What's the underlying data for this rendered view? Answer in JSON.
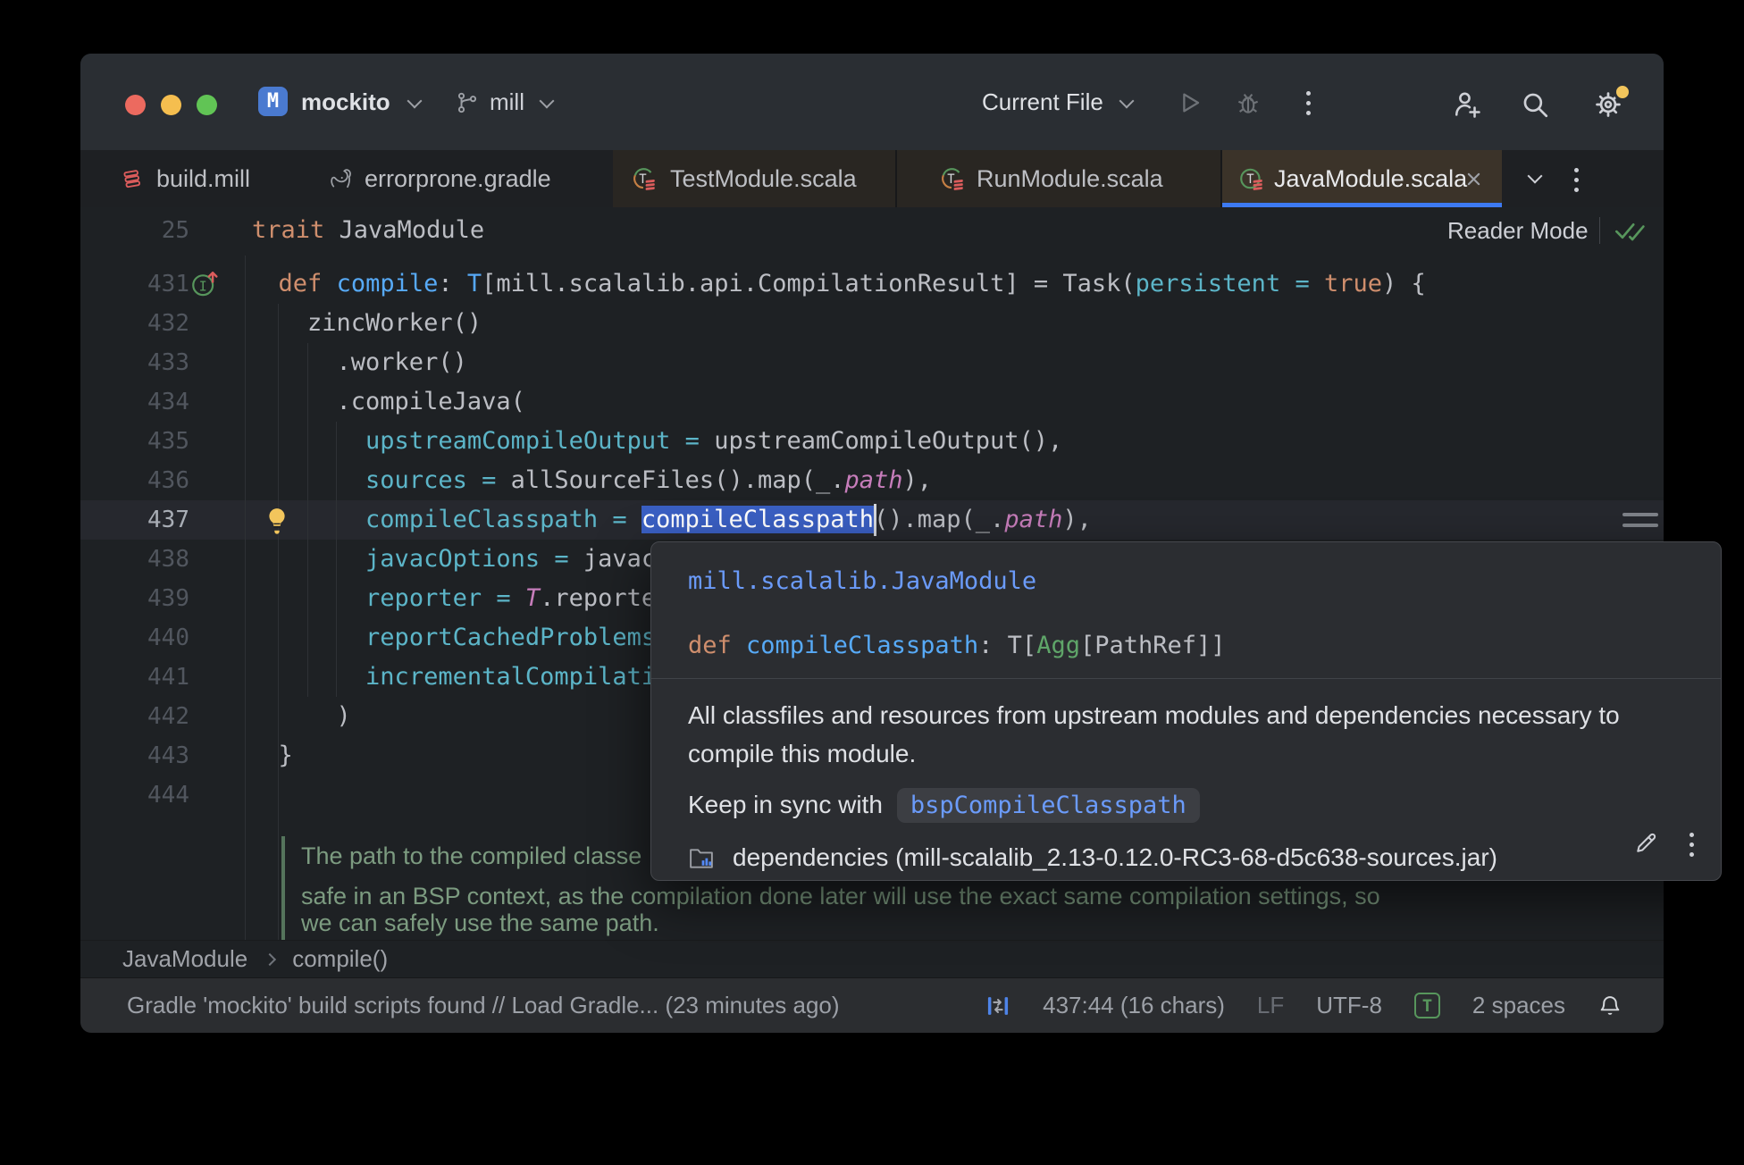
{
  "colors": {
    "accent_blue": "#3D7AF2",
    "selection_blue": "#3A5FC3",
    "link_blue": "#6B9BFA",
    "traffic_red": "#EC6A5F",
    "traffic_yellow": "#F5BE4F",
    "traffic_green": "#61C455",
    "notification_dot": "#F2C55C",
    "doc_comment_green": "#7C9B80"
  },
  "icons": {
    "project_badge": "M-letter-badge",
    "branch": "git-branch",
    "run": "play-triangle",
    "debug": "bug",
    "more": "kebab-menu",
    "collaborate": "person-plus",
    "search": "magnifier",
    "settings": "gear-with-dot",
    "mill_file": "red-stacked-bars",
    "gradle_file": "elephant",
    "scala_trait": "circle-T-with-red-bars",
    "override_marker": "circle-I-up-arrow",
    "intention": "lightbulb",
    "library_sources": "folder-with-blue-bars",
    "edit": "pencil",
    "notifications": "bell",
    "column_sync": "blue-bars-arrows"
  },
  "titlebar": {
    "project": "mockito",
    "branch": "mill",
    "run_config": "Current File"
  },
  "tabs": [
    {
      "label": "build.mill"
    },
    {
      "label": "errorprone.gradle"
    },
    {
      "label": "TestModule.scala"
    },
    {
      "label": "RunModule.scala"
    },
    {
      "label": "JavaModule.scala"
    }
  ],
  "sticky_header": {
    "line_number": "25",
    "keyword": "trait",
    "name": " JavaModule",
    "reader_mode_label": "Reader Mode"
  },
  "editor": {
    "lines": [
      {
        "n": "431",
        "tokens": [
          {
            "t": "  ",
            "s": "pl"
          },
          {
            "t": "def",
            "s": "kw"
          },
          {
            "t": " ",
            "s": "pl"
          },
          {
            "t": "compile",
            "s": "fn"
          },
          {
            "t": ": ",
            "s": "pl"
          },
          {
            "t": "T",
            "s": "ty"
          },
          {
            "t": "[mill.scalalib.api.CompilationResult] = Task(",
            "s": "pl"
          },
          {
            "t": "persistent",
            "s": "pa"
          },
          {
            "t": " ",
            "s": "pl"
          },
          {
            "t": "=",
            "s": "pa"
          },
          {
            "t": " ",
            "s": "pl"
          },
          {
            "t": "true",
            "s": "kw"
          },
          {
            "t": ") {",
            "s": "pl"
          }
        ]
      },
      {
        "n": "432",
        "tokens": [
          {
            "t": "    zincWorker()",
            "s": "pl"
          }
        ]
      },
      {
        "n": "433",
        "tokens": [
          {
            "t": "      .worker()",
            "s": "pl"
          }
        ]
      },
      {
        "n": "434",
        "tokens": [
          {
            "t": "      .compileJava(",
            "s": "pl"
          }
        ]
      },
      {
        "n": "435",
        "tokens": [
          {
            "t": "        ",
            "s": "pl"
          },
          {
            "t": "upstreamCompileOutput = ",
            "s": "pa"
          },
          {
            "t": "upstreamCompileOutput(),",
            "s": "pl"
          }
        ]
      },
      {
        "n": "436",
        "tokens": [
          {
            "t": "        ",
            "s": "pl"
          },
          {
            "t": "sources = ",
            "s": "pa"
          },
          {
            "t": "allSourceFiles().map(_.",
            "s": "pl"
          },
          {
            "t": "path",
            "s": "fi"
          },
          {
            "t": "),",
            "s": "pl"
          }
        ]
      },
      {
        "n": "437",
        "current": true,
        "tokens": [
          {
            "t": "        ",
            "s": "pl"
          },
          {
            "t": "compileClasspath = ",
            "s": "pa"
          },
          {
            "t": "compileClasspath",
            "s": "sel"
          },
          {
            "t": "().map(_.",
            "s": "pl"
          },
          {
            "t": "path",
            "s": "fi"
          },
          {
            "t": "),",
            "s": "pl"
          }
        ]
      },
      {
        "n": "438",
        "tokens": [
          {
            "t": "        ",
            "s": "pl"
          },
          {
            "t": "javacOptions = ",
            "s": "pa"
          },
          {
            "t": "javacO",
            "s": "pl"
          }
        ]
      },
      {
        "n": "439",
        "tokens": [
          {
            "t": "        ",
            "s": "pl"
          },
          {
            "t": "reporter = ",
            "s": "pa"
          },
          {
            "t": "T",
            "s": "tp"
          },
          {
            "t": ".reporter",
            "s": "pl"
          }
        ]
      },
      {
        "n": "440",
        "tokens": [
          {
            "t": "        ",
            "s": "pl"
          },
          {
            "t": "reportCachedProblems",
            "s": "pa"
          },
          {
            "t": " ",
            "s": "pl"
          }
        ]
      },
      {
        "n": "441",
        "tokens": [
          {
            "t": "        ",
            "s": "pl"
          },
          {
            "t": "incrementalCompilatio",
            "s": "pa"
          }
        ]
      },
      {
        "n": "442",
        "tokens": [
          {
            "t": "      )",
            "s": "pl"
          }
        ]
      },
      {
        "n": "443",
        "tokens": [
          {
            "t": "  }",
            "s": "pl"
          }
        ]
      },
      {
        "n": "444",
        "tokens": []
      }
    ],
    "doc_comment_lines": [
      "The path to the compiled classe",
      "safe in an BSP context, as the compilation done later will use the exact same compilation settings, so",
      "we can safely use the same path."
    ]
  },
  "popup": {
    "qualifier": "mill.scalalib.JavaModule",
    "signature_tokens": [
      {
        "t": "def",
        "s": "kw"
      },
      {
        "t": " ",
        "s": "pl"
      },
      {
        "t": "compileClasspath",
        "s": "fn"
      },
      {
        "t": ": ",
        "s": "pl"
      },
      {
        "t": "T",
        "s": "pl"
      },
      {
        "t": "[",
        "s": "pl"
      },
      {
        "t": "Agg",
        "s": "gr"
      },
      {
        "t": "[PathRef]]",
        "s": "pl"
      }
    ],
    "description_line1": "All classfiles and resources from upstream modules and dependencies necessary to",
    "description_line2": "compile this module.",
    "keep_in_sync_label": "Keep in sync with",
    "keep_in_sync_code": "bspCompileClasspath",
    "source_jar": "dependencies (mill-scalalib_2.13-0.12.0-RC3-68-d5c638-sources.jar)"
  },
  "breadcrumb": {
    "items": [
      "JavaModule",
      "compile()"
    ]
  },
  "statusbar": {
    "message": "Gradle 'mockito' build scripts found // Load Gradle... (23 minutes ago)",
    "caret_position": "437:44 (16 chars)",
    "line_ending": "LF",
    "encoding": "UTF-8",
    "indent_label": "T",
    "indent": "2 spaces"
  }
}
